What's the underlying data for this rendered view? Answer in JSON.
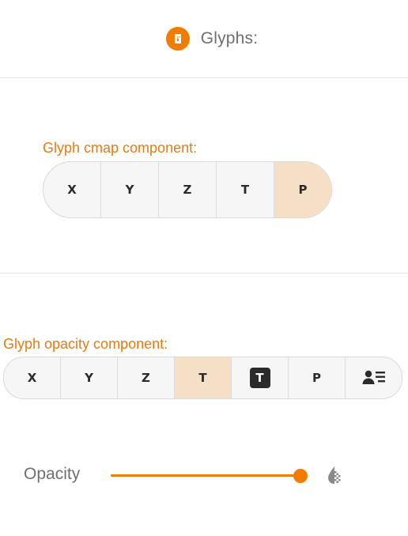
{
  "header": {
    "logo_letter": "G",
    "title": "Glyphs:"
  },
  "cmap": {
    "label": "Glyph cmap component:",
    "options": [
      "X",
      "Y",
      "Z",
      "T",
      "P"
    ],
    "selected": "P"
  },
  "opacity_component": {
    "label": "Glyph opacity component:",
    "options": [
      {
        "label": "X",
        "icon": null
      },
      {
        "label": "Y",
        "icon": null
      },
      {
        "label": "Z",
        "icon": null
      },
      {
        "label": "T",
        "icon": null
      },
      {
        "label": "T",
        "icon": "t-box-icon"
      },
      {
        "label": "P",
        "icon": null
      },
      {
        "label": "",
        "icon": "person-list-icon"
      }
    ],
    "selected_index": 3
  },
  "opacity": {
    "label": "Opacity",
    "value": 1.0,
    "icon": "opacity-icon"
  },
  "colors": {
    "accent": "#f07c00",
    "selected_bg": "#f6dfc7"
  }
}
